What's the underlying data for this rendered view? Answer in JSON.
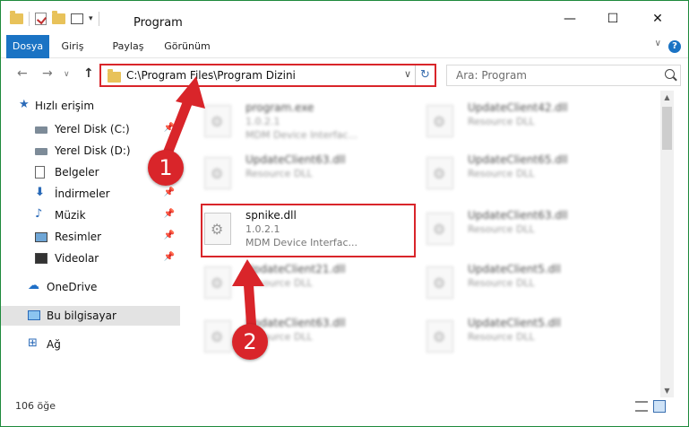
{
  "window": {
    "title": "Program",
    "controls": {
      "minimize": "—",
      "maximize": "☐",
      "close": "✕"
    }
  },
  "ribbon": {
    "tabs": [
      "Dosya",
      "Giriş",
      "Paylaş",
      "Görünüm"
    ],
    "active_tab": "Dosya",
    "help_label": "?"
  },
  "nav": {
    "back": "←",
    "forward": "→",
    "up": "↑",
    "address": "C:\\Program Files\\Program Dizini",
    "dropdown": "∨",
    "refresh": "↻",
    "search_placeholder": "Ara: Program"
  },
  "sidebar": {
    "items": [
      {
        "label": "Hızlı erişim",
        "icon": "quick-access-star-icon"
      },
      {
        "label": "Yerel Disk (C:)",
        "icon": "drive-icon",
        "pinned": true
      },
      {
        "label": "Yerel Disk (D:)",
        "icon": "drive-icon"
      },
      {
        "label": "Belgeler",
        "icon": "documents-icon",
        "pinned": true
      },
      {
        "label": "İndirmeler",
        "icon": "downloads-icon",
        "pinned": true
      },
      {
        "label": "Müzik",
        "icon": "music-icon",
        "pinned": true
      },
      {
        "label": "Resimler",
        "icon": "pictures-icon",
        "pinned": true
      },
      {
        "label": "Videolar",
        "icon": "videos-icon",
        "pinned": true
      },
      {
        "label": "OneDrive",
        "icon": "onedrive-icon"
      },
      {
        "label": "Bu bilgisayar",
        "icon": "this-pc-icon",
        "selected": true
      },
      {
        "label": "Ağ",
        "icon": "network-icon"
      }
    ],
    "pin_glyph": "📌"
  },
  "files": {
    "left": [
      {
        "name": "program.exe",
        "version": "1.0.2.1",
        "desc": "MDM Device Interfac..."
      },
      {
        "name": "UpdateClient63.dll",
        "version": "Resource DLL",
        "desc": ""
      },
      {
        "name": "spnike.dll",
        "version": "1.0.2.1",
        "desc": "MDM Device Interfac...",
        "highlighted": true
      },
      {
        "name": "UpdateClient21.dll",
        "version": "Resource DLL",
        "desc": ""
      },
      {
        "name": "UpdateClient63.dll",
        "version": "Resource DLL",
        "desc": ""
      }
    ],
    "right": [
      {
        "name": "UpdateClient42.dll",
        "version": "Resource DLL"
      },
      {
        "name": "UpdateClient65.dll",
        "version": "Resource DLL"
      },
      {
        "name": "UpdateClient63.dll",
        "version": "Resource DLL"
      },
      {
        "name": "UpdateClient5.dll",
        "version": "Resource DLL"
      },
      {
        "name": "UpdateClient5.dll",
        "version": "Resource DLL"
      }
    ]
  },
  "status": {
    "count": "106 öğe"
  },
  "annotations": {
    "step1": "1",
    "step2": "2",
    "color": "#d9252a"
  }
}
